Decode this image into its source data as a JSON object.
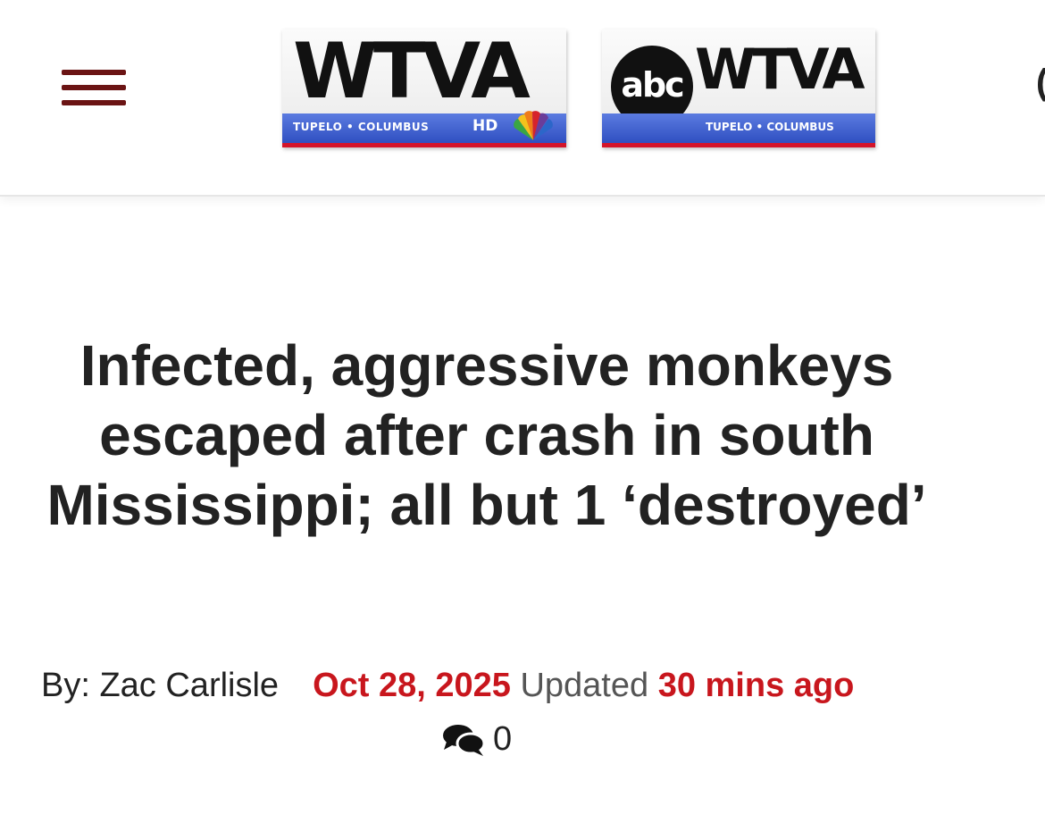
{
  "header": {
    "menu_icon": "hamburger-menu-icon",
    "logo_nbc": {
      "call": "WTVA",
      "tagline": "TUPELO • COLUMBUS",
      "hd": "HD"
    },
    "logo_abc": {
      "network": "abc",
      "call": "WTVA",
      "tagline": "TUPELO • COLUMBUS"
    },
    "colors": {
      "menu": "#6b1414",
      "strip": "#2f4fc1",
      "strip_border": "#d3142a"
    }
  },
  "article": {
    "headline": "Infected, aggressive monkeys escaped after crash in south Mississippi; all but 1 ‘destroyed’",
    "byline": "By: Zac Carlisle",
    "date": "Oct 28, 2025",
    "updated_label": "Updated",
    "updated_ago": "30 mins ago",
    "comment_icon": "comments-icon",
    "comment_count": "0",
    "colors": {
      "accent": "#c8161d"
    }
  }
}
